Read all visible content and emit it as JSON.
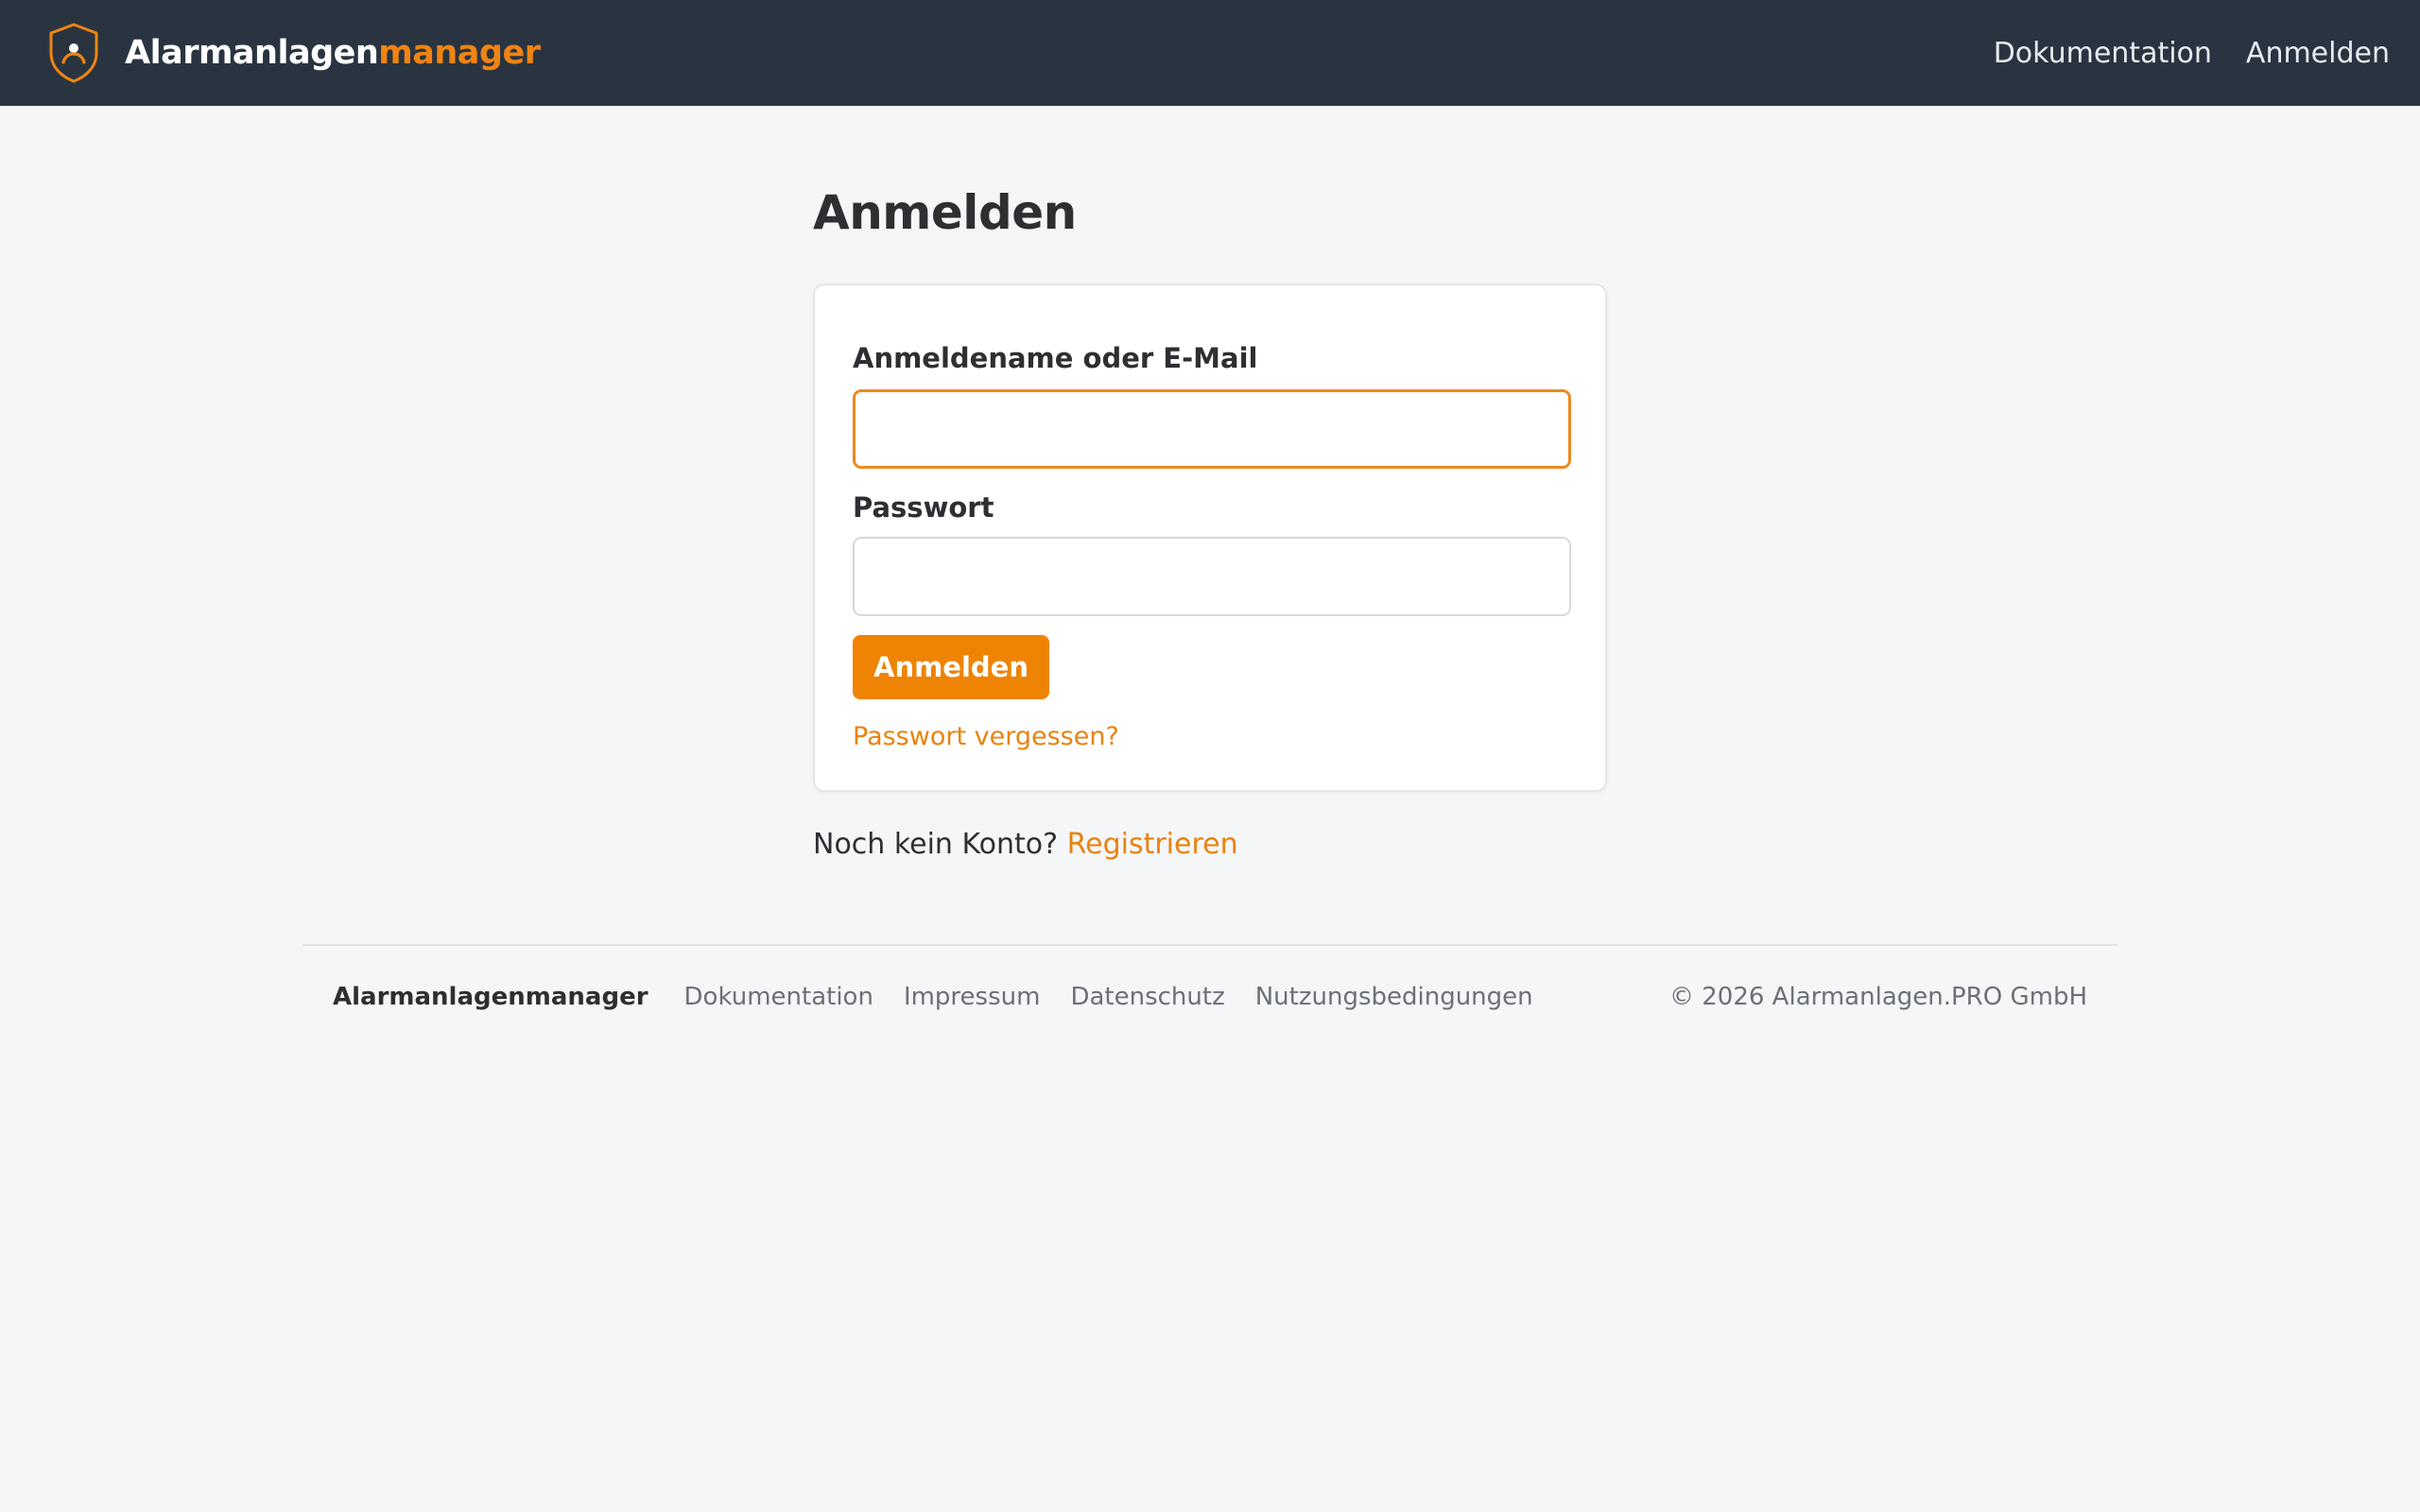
{
  "header": {
    "brand_part1": "Alarmanlagen",
    "brand_part2": "manager",
    "nav": [
      {
        "label": "Dokumentation"
      },
      {
        "label": "Anmelden"
      }
    ]
  },
  "main": {
    "title": "Anmelden",
    "form": {
      "username_label": "Anmeldename oder E-Mail",
      "username_value": "",
      "password_label": "Passwort",
      "password_value": "",
      "submit_label": "Anmelden",
      "forgot_label": "Passwort vergessen?"
    },
    "register_prompt": "Noch kein Konto?",
    "register_link": "Registrieren"
  },
  "footer": {
    "brand": "Alarmanlagenmanager",
    "links": [
      {
        "label": "Dokumentation"
      },
      {
        "label": "Impressum"
      },
      {
        "label": "Datenschutz"
      },
      {
        "label": "Nutzungsbedingungen"
      }
    ],
    "copyright": "© 2026 Alarmanlagen.PRO GmbH"
  },
  "colors": {
    "header_bg": "#2a3441",
    "accent": "#ef8304",
    "page_bg": "#f5f6f8"
  },
  "icons": {
    "logo": "shield-user-icon"
  }
}
